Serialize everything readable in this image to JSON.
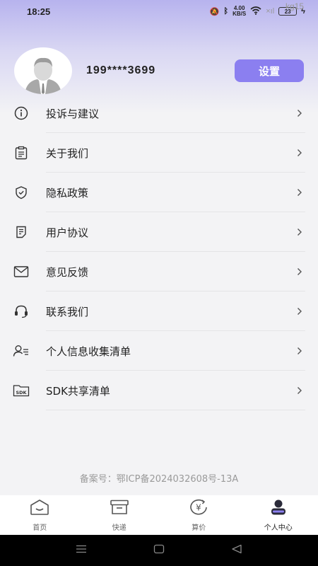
{
  "status_bar": {
    "time": "18:25",
    "speed": "4.00",
    "speed_unit": "KB/S",
    "battery": "23"
  },
  "watermark": "kg15",
  "profile": {
    "phone": "199****3699",
    "settings_label": "设置"
  },
  "menu": {
    "items": [
      {
        "label": "投诉与建议",
        "icon": "info-icon"
      },
      {
        "label": "关于我们",
        "icon": "clipboard-icon"
      },
      {
        "label": "隐私政策",
        "icon": "shield-icon"
      },
      {
        "label": "用户协议",
        "icon": "document-icon"
      },
      {
        "label": "意见反馈",
        "icon": "mail-icon"
      },
      {
        "label": "联系我们",
        "icon": "headset-icon"
      },
      {
        "label": "个人信息收集清单",
        "icon": "user-list-icon"
      },
      {
        "label": "SDK共享清单",
        "icon": "sdk-folder-icon"
      }
    ]
  },
  "footer": {
    "beian": "备案号：鄂ICP备2024032608号-13A"
  },
  "tabs": [
    {
      "label": "首页",
      "icon": "home-icon"
    },
    {
      "label": "快递",
      "icon": "box-icon"
    },
    {
      "label": "算价",
      "icon": "yuan-icon"
    },
    {
      "label": "个人中心",
      "icon": "person-icon",
      "active": true
    }
  ],
  "colors": {
    "accent": "#8b7ff0",
    "gradient_top": "#b7b3ee",
    "background": "#f3f3f5"
  }
}
